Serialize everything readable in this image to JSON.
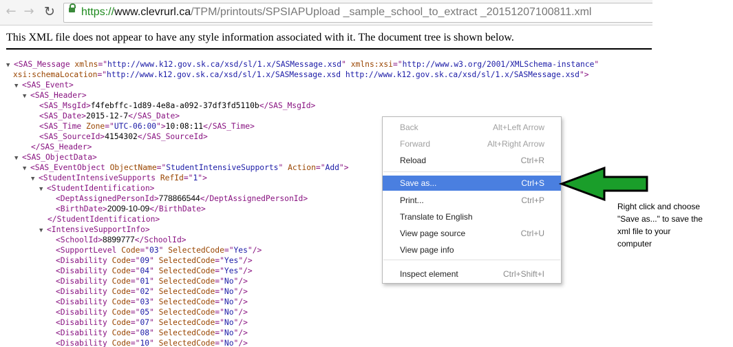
{
  "browser": {
    "url": {
      "scheme": "https://",
      "host": "www.clevrurl.ca",
      "path": "/TPM/printouts/SPSIAPUpload _sample_school_to_extract _20151207100811.xml"
    },
    "back_icon": "arrow-left-icon",
    "forward_icon": "arrow-right-icon",
    "reload_icon": "reload-icon",
    "lock_icon": "lock-icon"
  },
  "page": {
    "notice": "This XML file does not appear to have any style information associated with it. The document tree is shown below."
  },
  "xml": [
    {
      "d": 0,
      "t": 1,
      "h": [
        [
          "t",
          "<SAS_Message "
        ],
        [
          "n",
          "xmlns"
        ],
        [
          "t",
          "=\""
        ],
        [
          "v",
          "http://www.k12.gov.sk.ca/xsd/sl/1.x/SASMessage.xsd"
        ],
        [
          "t",
          "\" "
        ],
        [
          "n",
          "xmlns:xsi"
        ],
        [
          "t",
          "=\""
        ],
        [
          "v",
          "http://www.w3.org/2001/XMLSchema-instance"
        ],
        [
          "t",
          "\""
        ]
      ]
    },
    {
      "d": 0,
      "t": 0,
      "h": [
        [
          "n",
          "xsi:schemaLocation"
        ],
        [
          "t",
          "=\""
        ],
        [
          "v",
          "http://www.k12.gov.sk.ca/xsd/sl/1.x/SASMessage.xsd http://www.k12.gov.sk.ca/xsd/sl/1.x/SASMessage.xsd"
        ],
        [
          "t",
          "\">"
        ]
      ]
    },
    {
      "d": 1,
      "t": 1,
      "h": [
        [
          "t",
          "<SAS_Event>"
        ]
      ]
    },
    {
      "d": 2,
      "t": 1,
      "h": [
        [
          "t",
          "<SAS_Header>"
        ]
      ]
    },
    {
      "d": 3,
      "t": 0,
      "h": [
        [
          "t",
          "<SAS_MsgId>"
        ],
        [
          "x",
          "f4febffc-1d89-4e8a-a092-37df3fd5110b"
        ],
        [
          "t",
          "</SAS_MsgId>"
        ]
      ]
    },
    {
      "d": 3,
      "t": 0,
      "h": [
        [
          "t",
          "<SAS_Date>"
        ],
        [
          "x",
          "2015-12-7"
        ],
        [
          "t",
          "</SAS_Date>"
        ]
      ]
    },
    {
      "d": 3,
      "t": 0,
      "h": [
        [
          "t",
          "<SAS_Time "
        ],
        [
          "n",
          "Zone"
        ],
        [
          "t",
          "=\""
        ],
        [
          "v",
          "UTC-06:00"
        ],
        [
          "t",
          "\">"
        ],
        [
          "x",
          "10:08:11"
        ],
        [
          "t",
          "</SAS_Time>"
        ]
      ]
    },
    {
      "d": 3,
      "t": 0,
      "h": [
        [
          "t",
          "<SAS_SourceId>"
        ],
        [
          "x",
          "4154302"
        ],
        [
          "t",
          "</SAS_SourceId>"
        ]
      ]
    },
    {
      "d": 2,
      "t": 0,
      "h": [
        [
          "t",
          "</SAS_Header>"
        ]
      ]
    },
    {
      "d": 1,
      "t": 1,
      "h": [
        [
          "t",
          "<SAS_ObjectData>"
        ]
      ]
    },
    {
      "d": 2,
      "t": 1,
      "h": [
        [
          "t",
          "<SAS_EventObject "
        ],
        [
          "n",
          "ObjectName"
        ],
        [
          "t",
          "=\""
        ],
        [
          "v",
          "StudentIntensiveSupports"
        ],
        [
          "t",
          "\" "
        ],
        [
          "n",
          "Action"
        ],
        [
          "t",
          "=\""
        ],
        [
          "v",
          "Add"
        ],
        [
          "t",
          "\">"
        ]
      ]
    },
    {
      "d": 3,
      "t": 1,
      "h": [
        [
          "t",
          "<StudentIntensiveSupports "
        ],
        [
          "n",
          "RefId"
        ],
        [
          "t",
          "=\""
        ],
        [
          "v",
          "1"
        ],
        [
          "t",
          "\">"
        ]
      ]
    },
    {
      "d": 4,
      "t": 1,
      "h": [
        [
          "t",
          "<StudentIdentification>"
        ]
      ]
    },
    {
      "d": 5,
      "t": 0,
      "h": [
        [
          "t",
          "<DeptAssignedPersonId>"
        ],
        [
          "o",
          "778866544"
        ],
        [
          "t",
          "</DeptAssignedPersonId>"
        ]
      ]
    },
    {
      "d": 5,
      "t": 0,
      "h": [
        [
          "t",
          "<BirthDate>"
        ],
        [
          "o",
          "2009-10-09"
        ],
        [
          "t",
          "</BirthDate>"
        ]
      ]
    },
    {
      "d": 4,
      "t": 0,
      "h": [
        [
          "t",
          "</StudentIdentification>"
        ]
      ]
    },
    {
      "d": 4,
      "t": 1,
      "h": [
        [
          "t",
          "<IntensiveSupportInfo>"
        ]
      ]
    },
    {
      "d": 5,
      "t": 0,
      "h": [
        [
          "t",
          "<SchoolId>"
        ],
        [
          "o",
          "8899777"
        ],
        [
          "t",
          "</SchoolId>"
        ]
      ]
    },
    {
      "d": 5,
      "t": 0,
      "h": [
        [
          "t",
          "<SupportLevel "
        ],
        [
          "n",
          "Code"
        ],
        [
          "t",
          "=\""
        ],
        [
          "v",
          "03"
        ],
        [
          "t",
          "\" "
        ],
        [
          "n",
          "SelectedCode"
        ],
        [
          "t",
          "=\""
        ],
        [
          "v",
          "Yes"
        ],
        [
          "t",
          "\"/>"
        ]
      ]
    },
    {
      "d": 5,
      "t": 0,
      "h": [
        [
          "t",
          "<Disability "
        ],
        [
          "n",
          "Code"
        ],
        [
          "t",
          "=\""
        ],
        [
          "v",
          "09"
        ],
        [
          "t",
          "\" "
        ],
        [
          "n",
          "SelectedCode"
        ],
        [
          "t",
          "=\""
        ],
        [
          "v",
          "Yes"
        ],
        [
          "t",
          "\"/>"
        ]
      ]
    },
    {
      "d": 5,
      "t": 0,
      "h": [
        [
          "t",
          "<Disability "
        ],
        [
          "n",
          "Code"
        ],
        [
          "t",
          "=\""
        ],
        [
          "v",
          "04"
        ],
        [
          "t",
          "\" "
        ],
        [
          "n",
          "SelectedCode"
        ],
        [
          "t",
          "=\""
        ],
        [
          "v",
          "Yes"
        ],
        [
          "t",
          "\"/>"
        ]
      ]
    },
    {
      "d": 5,
      "t": 0,
      "h": [
        [
          "t",
          "<Disability "
        ],
        [
          "n",
          "Code"
        ],
        [
          "t",
          "=\""
        ],
        [
          "v",
          "01"
        ],
        [
          "t",
          "\" "
        ],
        [
          "n",
          "SelectedCode"
        ],
        [
          "t",
          "=\""
        ],
        [
          "v",
          "No"
        ],
        [
          "t",
          "\"/>"
        ]
      ]
    },
    {
      "d": 5,
      "t": 0,
      "h": [
        [
          "t",
          "<Disability "
        ],
        [
          "n",
          "Code"
        ],
        [
          "t",
          "=\""
        ],
        [
          "v",
          "02"
        ],
        [
          "t",
          "\" "
        ],
        [
          "n",
          "SelectedCode"
        ],
        [
          "t",
          "=\""
        ],
        [
          "v",
          "No"
        ],
        [
          "t",
          "\"/>"
        ]
      ]
    },
    {
      "d": 5,
      "t": 0,
      "h": [
        [
          "t",
          "<Disability "
        ],
        [
          "n",
          "Code"
        ],
        [
          "t",
          "=\""
        ],
        [
          "v",
          "03"
        ],
        [
          "t",
          "\" "
        ],
        [
          "n",
          "SelectedCode"
        ],
        [
          "t",
          "=\""
        ],
        [
          "v",
          "No"
        ],
        [
          "t",
          "\"/>"
        ]
      ]
    },
    {
      "d": 5,
      "t": 0,
      "h": [
        [
          "t",
          "<Disability "
        ],
        [
          "n",
          "Code"
        ],
        [
          "t",
          "=\""
        ],
        [
          "v",
          "05"
        ],
        [
          "t",
          "\" "
        ],
        [
          "n",
          "SelectedCode"
        ],
        [
          "t",
          "=\""
        ],
        [
          "v",
          "No"
        ],
        [
          "t",
          "\"/>"
        ]
      ]
    },
    {
      "d": 5,
      "t": 0,
      "h": [
        [
          "t",
          "<Disability "
        ],
        [
          "n",
          "Code"
        ],
        [
          "t",
          "=\""
        ],
        [
          "v",
          "07"
        ],
        [
          "t",
          "\" "
        ],
        [
          "n",
          "SelectedCode"
        ],
        [
          "t",
          "=\""
        ],
        [
          "v",
          "No"
        ],
        [
          "t",
          "\"/>"
        ]
      ]
    },
    {
      "d": 5,
      "t": 0,
      "h": [
        [
          "t",
          "<Disability "
        ],
        [
          "n",
          "Code"
        ],
        [
          "t",
          "=\""
        ],
        [
          "v",
          "08"
        ],
        [
          "t",
          "\" "
        ],
        [
          "n",
          "SelectedCode"
        ],
        [
          "t",
          "=\""
        ],
        [
          "v",
          "No"
        ],
        [
          "t",
          "\"/>"
        ]
      ]
    },
    {
      "d": 5,
      "t": 0,
      "h": [
        [
          "t",
          "<Disability "
        ],
        [
          "n",
          "Code"
        ],
        [
          "t",
          "=\""
        ],
        [
          "v",
          "10"
        ],
        [
          "t",
          "\" "
        ],
        [
          "n",
          "SelectedCode"
        ],
        [
          "t",
          "=\""
        ],
        [
          "v",
          "No"
        ],
        [
          "t",
          "\"/>"
        ]
      ]
    }
  ],
  "context_menu": {
    "items": [
      {
        "label": "Back",
        "shortcut": "Alt+Left Arrow",
        "state": "disabled"
      },
      {
        "label": "Forward",
        "shortcut": "Alt+Right Arrow",
        "state": "disabled"
      },
      {
        "label": "Reload",
        "shortcut": "Ctrl+R",
        "state": "enabled"
      },
      {
        "label": "Save as...",
        "shortcut": "Ctrl+S",
        "state": "highlighted"
      },
      {
        "label": "Print...",
        "shortcut": "Ctrl+P",
        "state": "enabled"
      },
      {
        "label": "Translate to English",
        "shortcut": "",
        "state": "enabled"
      },
      {
        "label": "View page source",
        "shortcut": "Ctrl+U",
        "state": "enabled"
      },
      {
        "label": "View page info",
        "shortcut": "",
        "state": "enabled"
      },
      {
        "label": "Inspect element",
        "shortcut": "Ctrl+Shift+I",
        "state": "enabled"
      }
    ]
  },
  "annotation": {
    "arrow_color": "#1a9e2a",
    "arrow_icon": "arrow-left-icon",
    "note_lines": [
      "Right click and choose",
      "\"Save as...\" to save the",
      "xml file to your",
      "computer"
    ]
  },
  "colors": {
    "tag": "#881280",
    "attr_name": "#994500",
    "attr_value": "#1a1aa6",
    "menu_highlight": "#4a7fe0"
  }
}
